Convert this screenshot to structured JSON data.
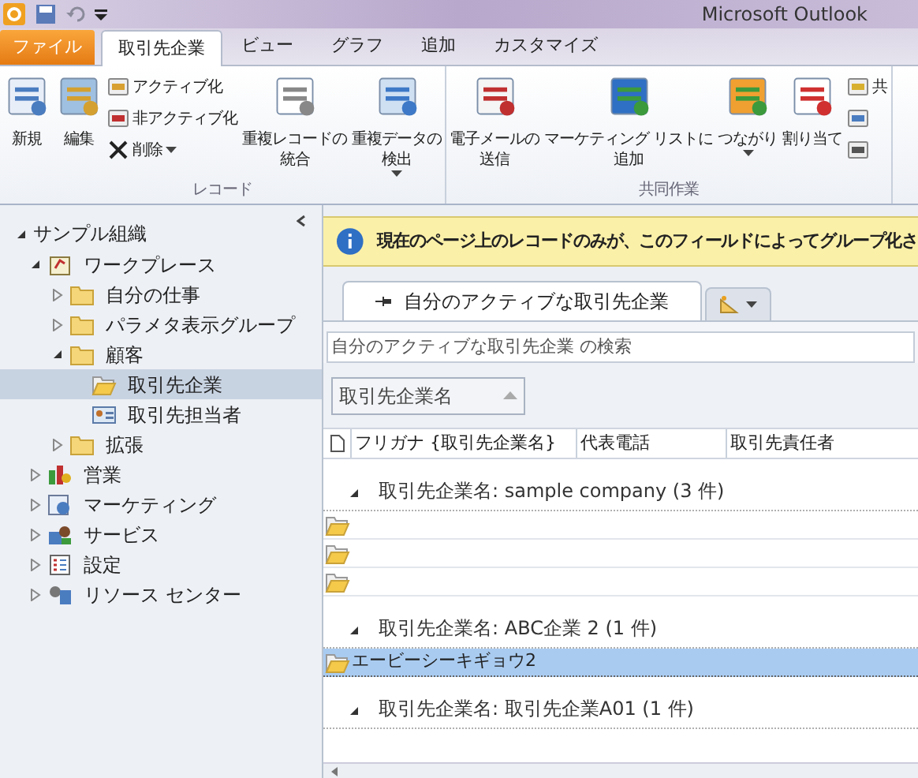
{
  "window": {
    "title": "Microsoft Outlook"
  },
  "tabs": [
    {
      "label": "ファイル",
      "kind": "file",
      "selected": false
    },
    {
      "label": "取引先企業",
      "kind": "tab",
      "selected": true
    },
    {
      "label": "ビュー",
      "kind": "tab",
      "selected": false
    },
    {
      "label": "グラフ",
      "kind": "tab",
      "selected": false
    },
    {
      "label": "追加",
      "kind": "tab",
      "selected": false
    },
    {
      "label": "カスタマイズ",
      "kind": "tab",
      "selected": false
    }
  ],
  "ribbon": {
    "groups": [
      {
        "label": "レコード",
        "buttons": [
          {
            "kind": "large",
            "lines": [
              "新規"
            ],
            "dropdown": false
          },
          {
            "kind": "large",
            "lines": [
              "編集"
            ],
            "dropdown": false
          },
          {
            "kind": "stack",
            "items": [
              {
                "label": "アクティブ化",
                "dropdown": false
              },
              {
                "label": "非アクティブ化",
                "dropdown": false
              },
              {
                "label": "削除",
                "dropdown": true
              }
            ]
          },
          {
            "kind": "large",
            "lines": [
              "重複レコードの",
              "統合"
            ],
            "dropdown": false
          },
          {
            "kind": "large",
            "lines": [
              "重複データの",
              "検出"
            ],
            "dropdown": true
          }
        ]
      },
      {
        "label": "共同作業",
        "buttons": [
          {
            "kind": "large",
            "lines": [
              "電子メールの",
              "送信"
            ],
            "dropdown": false
          },
          {
            "kind": "large",
            "lines": [
              "マーケティング リストに",
              "追加"
            ],
            "dropdown": false
          },
          {
            "kind": "large",
            "lines": [
              "つながり"
            ],
            "dropdown": true
          },
          {
            "kind": "large",
            "lines": [
              "割り当て"
            ],
            "dropdown": false
          },
          {
            "kind": "stack",
            "items": [
              {
                "label": "共",
                "dropdown": false
              },
              {
                "dropdown": false
              },
              {
                "dropdown": false
              }
            ]
          }
        ]
      }
    ]
  },
  "sidebar": {
    "tree": [
      {
        "label": "サンプル組織",
        "expanded": true,
        "selected": false,
        "children": [
          {
            "label": "ワークプレース",
            "kind": "workplace",
            "expanded": true,
            "selected": false,
            "children": [
              {
                "label": "自分の仕事",
                "kind": "folder",
                "expanded": false,
                "selected": false
              },
              {
                "label": "パラメタ表示グループ",
                "kind": "folder",
                "expanded": false,
                "selected": false
              },
              {
                "label": "顧客",
                "kind": "folder",
                "expanded": true,
                "selected": false,
                "children": [
                  {
                    "label": "取引先企業",
                    "kind": "account",
                    "selected": true
                  },
                  {
                    "label": "取引先担当者",
                    "kind": "contact",
                    "selected": false
                  }
                ]
              },
              {
                "label": "拡張",
                "kind": "folder",
                "expanded": false,
                "selected": false
              }
            ]
          },
          {
            "label": "営業",
            "kind": "sales",
            "expanded": false,
            "selected": false
          },
          {
            "label": "マーケティング",
            "kind": "marketing",
            "expanded": false,
            "selected": false
          },
          {
            "label": "サービス",
            "kind": "service",
            "expanded": false,
            "selected": false
          },
          {
            "label": "設定",
            "kind": "settings",
            "expanded": false,
            "selected": false
          },
          {
            "label": "リソース センター",
            "kind": "resource",
            "expanded": false,
            "selected": false
          }
        ]
      }
    ]
  },
  "info_bar": {
    "message": "現在のページ上のレコードのみが、このフィールドによってグループ化さ"
  },
  "view_tabs": [
    {
      "label": "自分のアクティブな取引先企業",
      "kind": "view",
      "selected": true
    },
    {
      "kind": "new",
      "selected": false
    }
  ],
  "search": {
    "placeholder": "自分のアクティブな取引先企業 の検索"
  },
  "group_by": {
    "label": "取引先企業名"
  },
  "table": {
    "columns": [
      "フリガナ {取引先企業名}",
      "代表電話",
      "取引先責任者"
    ],
    "groups": [
      {
        "label": "取引先企業名: sample company (3 件)",
        "expanded": true,
        "rows": [
          {
            "cells": [],
            "selected": false
          },
          {
            "cells": [],
            "selected": false
          },
          {
            "cells": [],
            "selected": false
          }
        ]
      },
      {
        "label": "取引先企業名: ABC企業 2 (1 件)",
        "expanded": true,
        "rows": [
          {
            "cells": [
              "エービーシーキギョウ2"
            ],
            "selected": true
          }
        ]
      },
      {
        "label": "取引先企業名: 取引先企業A01 (1 件)",
        "expanded": true
      }
    ]
  }
}
